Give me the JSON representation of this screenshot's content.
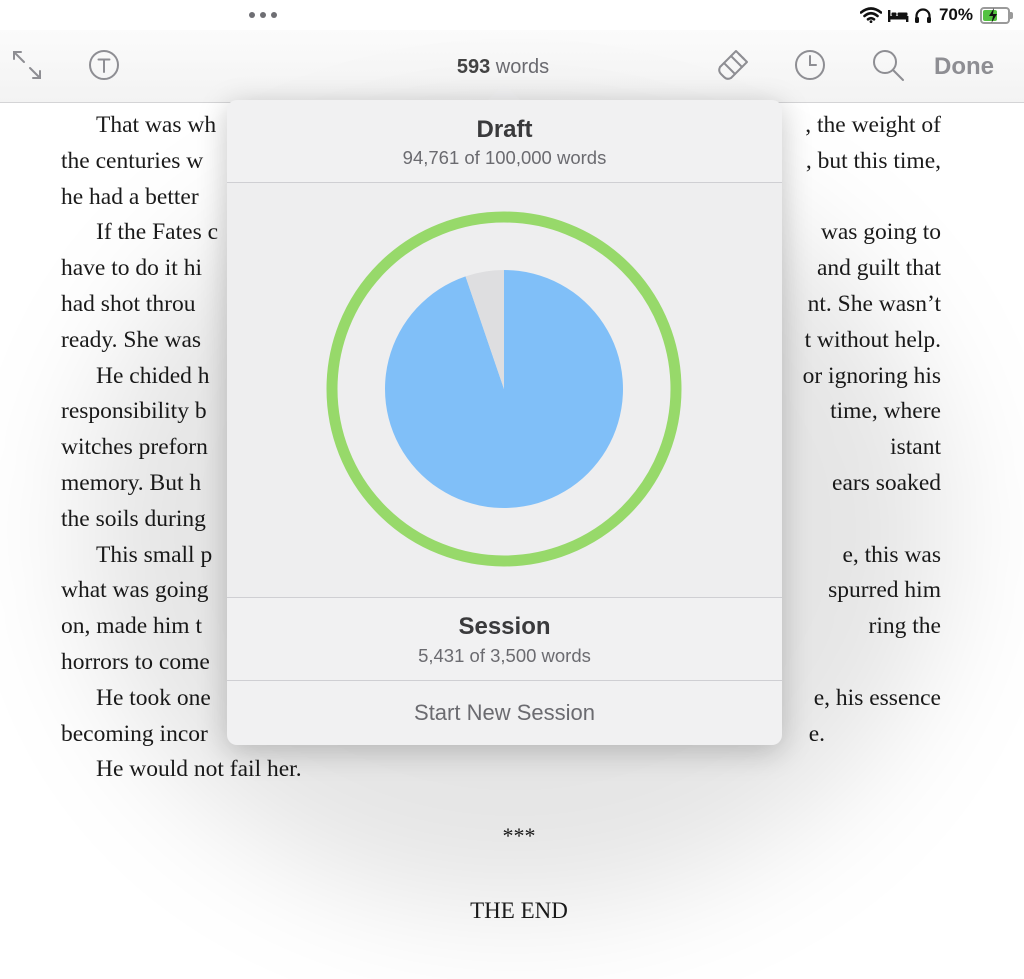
{
  "status_bar": {
    "battery_percent": "70%",
    "battery_level": 0.7,
    "icons": [
      "wifi-icon",
      "bed-icon",
      "headphones-icon",
      "battery-charging-icon"
    ]
  },
  "toolbar": {
    "word_count_number": "593",
    "word_count_unit": "words",
    "done_label": "Done",
    "icons": [
      "fullscreen-icon",
      "typewriter-icon",
      "brush-icon",
      "clock-icon",
      "search-icon"
    ]
  },
  "manuscript": {
    "lines": [
      {
        "text": "That was wh",
        "right": ", the weight of",
        "indent": true
      },
      {
        "text": "the centuries w",
        "right": ", but this time,",
        "indent": false
      },
      {
        "text": "he had a better",
        "right": "",
        "indent": false
      },
      {
        "text": "If the Fates c",
        "right": "was going to",
        "indent": true
      },
      {
        "text": "have to do it hi",
        "right": "and guilt that",
        "indent": false
      },
      {
        "text": "had shot throu",
        "right": "nt. She wasn’t",
        "indent": false
      },
      {
        "text": "ready. She was",
        "right": "t without help.",
        "indent": false
      },
      {
        "text": "He chided h",
        "right": "or ignoring his",
        "indent": true
      },
      {
        "text": "responsibility b",
        "right": "time, where",
        "indent": false
      },
      {
        "text": "witches preforn",
        "right": "istant",
        "indent": false
      },
      {
        "text": "memory. But h",
        "right": "ears soaked",
        "indent": false
      },
      {
        "text": "the soils during",
        "right": "",
        "indent": false
      },
      {
        "text": "This small p",
        "right": "e, this was",
        "indent": true
      },
      {
        "text": "what was going",
        "right": "spurred him",
        "indent": false
      },
      {
        "text": "on, made him t",
        "right": "ring the",
        "indent": false
      },
      {
        "text": "horrors to come",
        "right": "",
        "indent": false
      },
      {
        "text": "He took one",
        "right": "e, his essence",
        "indent": true
      },
      {
        "text": "becoming incor",
        "right": "e.",
        "indent": false
      },
      {
        "text": "He would not fail her.",
        "right": "",
        "indent": true
      }
    ],
    "separator": "***",
    "ending": "THE END"
  },
  "popover": {
    "draft_title": "Draft",
    "draft_progress": "94,761 of 100,000 words",
    "session_title": "Session",
    "session_progress": "5,431 of 3,500 words",
    "action_label": "Start New Session"
  },
  "chart_data": {
    "type": "pie",
    "title": "",
    "slices": [
      {
        "label": "",
        "value": 94761,
        "color": "#80bff8"
      },
      {
        "label": "",
        "value": 5239,
        "color": "#dedee0"
      }
    ],
    "ring": {
      "label": "",
      "value": 5431,
      "target": 3500,
      "color": "#97d96a"
    }
  },
  "colors": {
    "draft_fill": "#80bff8",
    "draft_remaining": "#dedee0",
    "session_ring": "#97d96a",
    "popover_bg": "#f1f1f2",
    "toolbar_text": "#8e8e93"
  }
}
